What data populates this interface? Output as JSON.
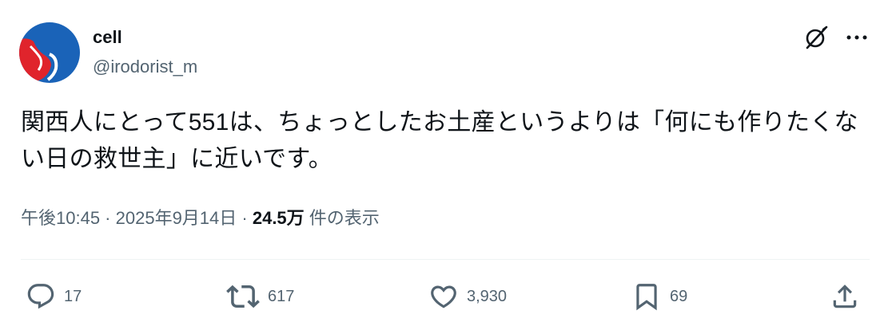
{
  "author": {
    "name": "cell",
    "handle": "@irodorist_m"
  },
  "tweet": {
    "text": "関西人にとって551は、ちょっとしたお土産というよりは「何にも作りたくない日の救世主」に近いです。"
  },
  "meta": {
    "time": "午後10:45",
    "separator1": " · ",
    "date": "2025年9月14日",
    "separator2": " · ",
    "views_count": "24.5万",
    "views_label": " 件の表示"
  },
  "actions": {
    "reply_count": "17",
    "retweet_count": "617",
    "like_count": "3,930",
    "bookmark_count": "69"
  },
  "icons": {
    "header": [
      "grok-icon",
      "more-icon"
    ],
    "actions": [
      "reply-icon",
      "retweet-icon",
      "like-icon",
      "bookmark-icon",
      "share-icon"
    ]
  },
  "colors": {
    "text_primary": "#0f1419",
    "text_secondary": "#536471",
    "divider": "#eff3f4",
    "avatar_blue": "#1a63b8",
    "avatar_red": "#e0242c"
  }
}
